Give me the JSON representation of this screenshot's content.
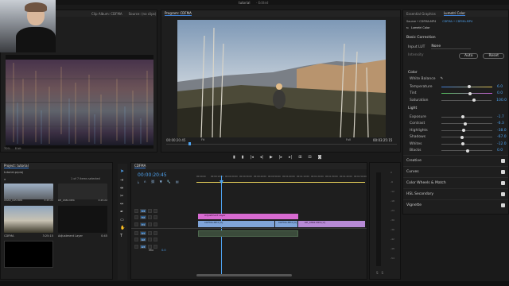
{
  "app": {
    "window_title": "tutorial",
    "edited_label": "- Edited"
  },
  "scopes": {
    "tab_left": "Clip Album: CDFMA",
    "tab_right": "Source: (no clips)",
    "bottom_label": "8 bit",
    "zoom": "70%"
  },
  "program": {
    "tab_label": "Program: CDFMA",
    "timecode_left": "00:00:20:45",
    "fit_label": "Fit",
    "full_label": "Full",
    "timecode_right": "00:03:25:15"
  },
  "lumetri": {
    "tab_essential": "Essential Graphics",
    "tab_lumetri": "Lumetri Color",
    "master_label": "Source • CDFMA.MP4",
    "clip_label": "CDFMA • CDFMA.MP4",
    "fx_label": "Lumetri Color",
    "basic_correction": "Basic Correction",
    "input_lut_label": "Input LUT",
    "input_lut_value": "None",
    "intensity_label": "Intensity",
    "auto_label": "Auto",
    "reset_label": "Reset",
    "color_header": "Color",
    "white_balance_label": "White Balance",
    "sliders_color": [
      {
        "label": "Temperature",
        "value": "6.0",
        "fraction": 0.53
      },
      {
        "label": "Tint",
        "value": "0.0",
        "fraction": 0.55
      },
      {
        "label": "Saturation",
        "value": "100.0",
        "fraction": 0.63
      }
    ],
    "light_header": "Light",
    "sliders_light": [
      {
        "label": "Exposure",
        "value": "-1.7",
        "fraction": 0.4
      },
      {
        "label": "Contrast",
        "value": "-6.3",
        "fraction": 0.45
      },
      {
        "label": "Highlights",
        "value": "-38.0",
        "fraction": 0.42
      },
      {
        "label": "Shadows",
        "value": "-67.0",
        "fraction": 0.39
      },
      {
        "label": "Whites",
        "value": "-12.0",
        "fraction": 0.41
      },
      {
        "label": "Blacks",
        "value": "0.0",
        "fraction": 0.5
      }
    ],
    "sections": [
      "Creative",
      "Curves",
      "Color Wheels & Match",
      "HSL Secondary",
      "Vignette"
    ]
  },
  "project": {
    "tab_label": "Project: tutorial",
    "file_label": "tutorial.prproj",
    "count_label": "1 of 7 items selected",
    "items": [
      {
        "name": "CDFMA",
        "duration": "3:25:15"
      },
      {
        "name": "Adjustment Layer",
        "duration": "0:45"
      }
    ],
    "top_items": [
      {
        "name": "CDAO_045.MP4",
        "duration": "3:25:22"
      },
      {
        "name": "DE_0382.MP4",
        "duration": "3:25:22"
      }
    ]
  },
  "timeline": {
    "tab_label": "CDFMA",
    "timecode": "00:00:20:45",
    "ruler": [
      "00:00:00",
      "00:00:10:00",
      "00:00:20:00",
      "00:00:30:00",
      "00:00:40:00",
      "00:00:50:00",
      "00:01:00:00",
      "00:01:10:00",
      "00:01:20:00",
      "00:01:30:00",
      "00:01:40:00",
      "00:01:50:00"
    ],
    "video_tracks": [
      "V3",
      "V2",
      "V1"
    ],
    "audio_tracks": [
      "A1",
      "A2",
      "A3"
    ],
    "mix_label": "Mix",
    "mix_value": "0.0",
    "clips": {
      "adjustment": "Adjustment Layer",
      "v1_a": "CDFMA.MP4 [V]",
      "v1_b": "CDFMA.MP4 [V]",
      "v1_c": "DE_0382.MP4 [V]"
    }
  },
  "meters": {
    "scale": [
      "0",
      "-6",
      "-12",
      "-18",
      "-24",
      "-30",
      "-36",
      "-42",
      "-48",
      "-54"
    ],
    "labels": [
      "S",
      "S"
    ]
  }
}
